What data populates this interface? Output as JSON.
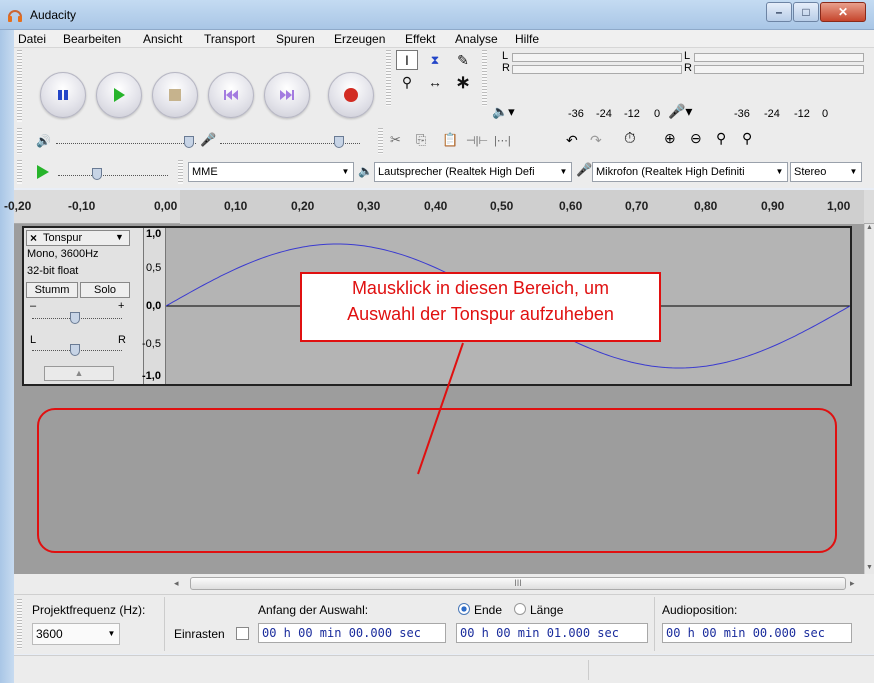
{
  "window": {
    "title": "Audacity",
    "minimize": "–",
    "maximize": "□",
    "close": "✕"
  },
  "menu": [
    "Datei",
    "Bearbeiten",
    "Ansicht",
    "Transport",
    "Spuren",
    "Erzeugen",
    "Effekt",
    "Analyse",
    "Hilfe"
  ],
  "meters": {
    "left": "L",
    "right": "R",
    "scale_play": [
      "-36",
      "-24",
      "-12",
      "0"
    ],
    "scale_rec": [
      "-36",
      "-24",
      "-12",
      "0"
    ]
  },
  "device": {
    "host": "MME",
    "playback": "Lautsprecher (Realtek High Defi",
    "recording": "Mikrofon (Realtek High Definiti",
    "channels": "Stereo"
  },
  "ruler": {
    "labels": [
      "-0,20",
      "-0,10",
      "0,00",
      "0,10",
      "0,20",
      "0,30",
      "0,40",
      "0,50",
      "0,60",
      "0,70",
      "0,80",
      "0,90",
      "1,00"
    ]
  },
  "track": {
    "name": "Tonspur",
    "close": "×",
    "info1": "Mono, 3600Hz",
    "info2": "32-bit float",
    "mute": "Stumm",
    "solo": "Solo",
    "gain_minus": "–",
    "gain_plus": "+",
    "pan_left": "L",
    "pan_right": "R",
    "axis": [
      "1,0",
      "0,5",
      "0,0",
      "-0,5",
      "-1,0"
    ]
  },
  "annotation": {
    "line1": "Mausklick in diesen Bereich, um",
    "line2": "Auswahl der Tonspur aufzuheben"
  },
  "selection_bar": {
    "rate_label": "Projektfrequenz (Hz):",
    "rate_value": "3600",
    "snap_label": "Einrasten",
    "start_label": "Anfang der Auswahl:",
    "end_label": "Ende",
    "length_label": "Länge",
    "audio_pos_label": "Audioposition:",
    "start_time": "00 h 00 min 00.000 sec",
    "end_time": "00 h 00 min 01.000 sec",
    "audio_pos_time": "00 h 00 min 00.000 sec"
  },
  "hscroll": {
    "thumb_mark": "III"
  },
  "colors": {
    "accent_red": "#e01010",
    "waveform": "#3a3ad0",
    "timecode": "#1a2c9c"
  }
}
